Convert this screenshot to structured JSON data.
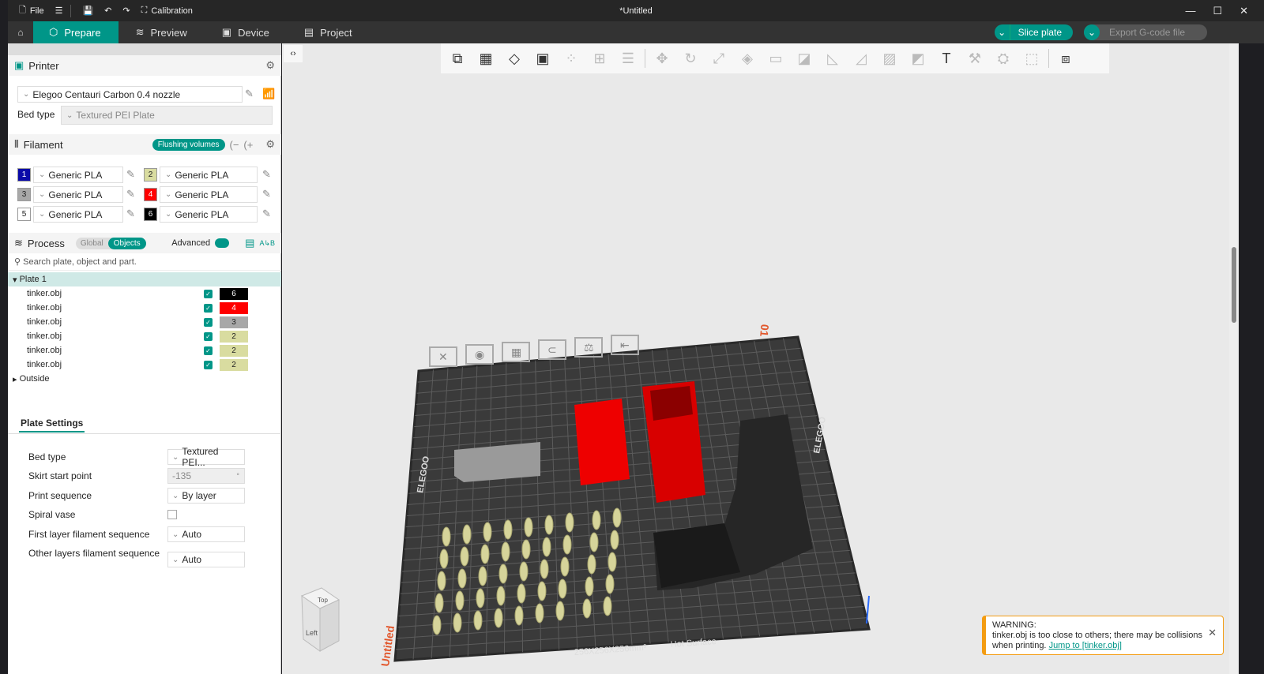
{
  "titlebar": {
    "file": "File",
    "calibration": "Calibration",
    "title": "*Untitled"
  },
  "tabs": [
    {
      "label": "Prepare"
    },
    {
      "label": "Preview"
    },
    {
      "label": "Device"
    },
    {
      "label": "Project"
    }
  ],
  "actions": {
    "slice": "Slice plate",
    "export": "Export G-code file"
  },
  "printer": {
    "header": "Printer",
    "name": "Elegoo Centauri Carbon 0.4 nozzle",
    "bed_label": "Bed type",
    "bed_value": "Textured PEI Plate"
  },
  "filament": {
    "header": "Filament",
    "flushing": "Flushing volumes",
    "slots": [
      {
        "n": "1",
        "color": "#0a0aa8",
        "fg": "#fff",
        "name": "Generic PLA"
      },
      {
        "n": "2",
        "color": "#d9dca0",
        "fg": "#222",
        "name": "Generic PLA"
      },
      {
        "n": "3",
        "color": "#a8a8a8",
        "fg": "#222",
        "name": "Generic PLA"
      },
      {
        "n": "4",
        "color": "#ff0000",
        "fg": "#fff",
        "name": "Generic PLA"
      },
      {
        "n": "5",
        "color": "#ffffff",
        "fg": "#222",
        "name": "Generic PLA"
      },
      {
        "n": "6",
        "color": "#000000",
        "fg": "#fff",
        "name": "Generic PLA"
      }
    ]
  },
  "process": {
    "header": "Process",
    "global": "Global",
    "objects": "Objects",
    "advanced": "Advanced",
    "search_placeholder": "Search plate, object and part."
  },
  "tree": {
    "plate": "Plate 1",
    "outside": "Outside",
    "objects": [
      {
        "name": "tinker.obj",
        "fil": "6",
        "color": "#000000",
        "fg": "#fff"
      },
      {
        "name": "tinker.obj",
        "fil": "4",
        "color": "#ff0000",
        "fg": "#fff"
      },
      {
        "name": "tinker.obj",
        "fil": "3",
        "color": "#a8a8a8",
        "fg": "#222"
      },
      {
        "name": "tinker.obj",
        "fil": "2",
        "color": "#d9dca0",
        "fg": "#222"
      },
      {
        "name": "tinker.obj",
        "fil": "2",
        "color": "#d9dca0",
        "fg": "#222"
      },
      {
        "name": "tinker.obj",
        "fil": "2",
        "color": "#d9dca0",
        "fg": "#222"
      }
    ]
  },
  "plate_settings": {
    "tab": "Plate Settings",
    "rows": [
      {
        "label": "Bed type",
        "value": "Textured PEI..."
      },
      {
        "label": "Skirt start point",
        "value": "-135"
      },
      {
        "label": "Print sequence",
        "value": "By layer"
      },
      {
        "label": "Spiral vase",
        "value": ""
      },
      {
        "label": "First layer filament sequence",
        "value": "Auto"
      },
      {
        "label": "Other layers filament sequence",
        "value": "Auto"
      }
    ],
    "skirt_unit": "°"
  },
  "viewport": {
    "plate_number": "01",
    "bed_size": "256X256X256mm³",
    "hot_surface": "Hot Surface",
    "brand": "ELEGOO",
    "cube_top": "Top",
    "cube_left": "Left",
    "side_label": "Untitled"
  },
  "warning": {
    "title": "WARNING:",
    "text": "tinker.obj is too close to others; there may be collisions when printing.",
    "link": "Jump to [tinker.obj]"
  }
}
